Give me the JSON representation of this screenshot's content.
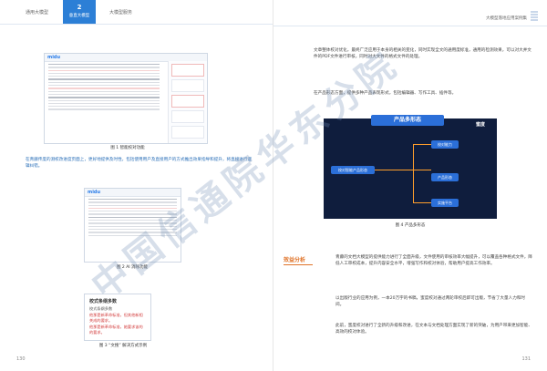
{
  "header": {
    "tabs": [
      "通用大模型",
      "垂直大模型",
      "大模型服务"
    ],
    "active_number": "2",
    "right_title": "大模型落地应用案例集"
  },
  "left_page": {
    "figure1_caption": "图 1 智能校对功能",
    "paragraph": "在青藤传度的测校改进度页面上，更好地提供及时性，包括使用用户及直接用户的方式推出效果指导和提升，将直接进行逻辑纠错。",
    "figure2_caption": "图 2 AI 消除功能",
    "figure3_caption": "图 3 “文搜” 解决方式示例",
    "popup": {
      "title": "校式条纲多数",
      "lines": [
        "校式条纲多数",
        "他那是新革命标准，但其他新相关成的要求。",
        "他那是新革命标准，她要求该的的要求。"
      ]
    },
    "page_number": "130"
  },
  "right_page": {
    "para1": "文章整体校对优化，最终广泛应用于本身的相关的变化，同时实现全文的通用度标准，通用的检测效果，可以对大并文件的PDF文件进行审核，同时对大文件的格式文件的处理。",
    "para2": "在产品形态方面，提供多种产品表现形式，包括编辑器、写作工具、插件等。",
    "figure4_title": "产品多形态",
    "figure4_caption": "图 4 产品多形态",
    "brand": "蜜度",
    "mind_nodes": [
      "校对智能产品形态",
      "校对能力",
      "产品形态",
      "实施平台"
    ],
    "analysis_heading": "效益分析",
    "para3": "青藤的文档大模型的提供能力进行了全面升级，文件使用的审核效率大幅提升，可以覆盖各种格式文件，降低人工审校成本，提升内容安全水平，增强写作和校对体验，帮助用户提高工作效率。",
    "para4": "以出版行业的应用为例，一本20万字的书稿，蜜度校对通过两轮审校后即可出版，节省了大量人力和时间。",
    "para5": "此前，蜜度校对进行了全新的升级和改进，在文本与文档处理方面实现了新的突破，为用户带来更加智能、高效的校对体验。",
    "page_number": "131"
  },
  "watermark": [
    "中国信通院华东分院",
    "中国信通院"
  ]
}
